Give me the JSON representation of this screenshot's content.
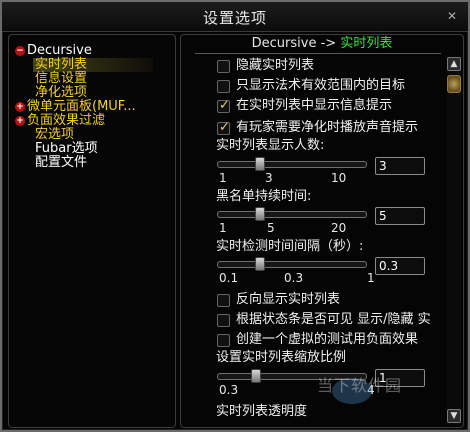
{
  "window": {
    "title": "设置选项",
    "close": "✕"
  },
  "tree": {
    "items": [
      {
        "label": "Decursive",
        "color": "#ffffff",
        "toggle": "−"
      },
      {
        "label": "实时列表",
        "color": "#f5d020"
      },
      {
        "label": "信息设置",
        "color": "#f5d020"
      },
      {
        "label": "净化选项",
        "color": "#f5d020"
      },
      {
        "label": "微单元面板(MUF...",
        "color": "#f5d020",
        "toggle": "+"
      },
      {
        "label": "负面效果过滤",
        "color": "#f5d020",
        "toggle": "+"
      },
      {
        "label": "宏选项",
        "color": "#f5d020"
      },
      {
        "label": "Fubar选项",
        "color": "#ffffff"
      },
      {
        "label": "配置文件",
        "color": "#ffffff"
      }
    ]
  },
  "panel": {
    "header_prefix": "Decursive -> ",
    "header_current": "实时列表",
    "options": [
      {
        "label": "隐藏实时列表",
        "checked": false
      },
      {
        "label": "只显示法术有效范围内的目标",
        "checked": false
      },
      {
        "label": "在实时列表中显示信息提示",
        "checked": true
      },
      {
        "label": "有玩家需要净化时播放声音提示",
        "checked": true
      }
    ],
    "slider_count": {
      "label": "实时列表显示人数:",
      "ticks": [
        "1",
        "3",
        "10"
      ],
      "value": "3"
    },
    "slider_blacklist": {
      "label": "黑名单持续时间:",
      "ticks": [
        "1",
        "5",
        "20"
      ],
      "value": "5"
    },
    "slider_interval": {
      "label": "实时检测时间间隔（秒）:",
      "ticks": [
        "0.1",
        "0.3",
        "1"
      ],
      "value": "0.3"
    },
    "options2": [
      {
        "label": "反向显示实时列表",
        "checked": false
      },
      {
        "label": "根据状态条是否可见 显示/隐藏 实",
        "checked": false
      },
      {
        "label": "创建一个虚拟的测试用负面效果",
        "checked": false
      }
    ],
    "slider_scale": {
      "label": "设置实时列表缩放比例",
      "ticks": [
        "0.3",
        "4"
      ],
      "value": "1"
    },
    "partial_label": "实时列表透明度"
  },
  "watermark": "当下软件园"
}
